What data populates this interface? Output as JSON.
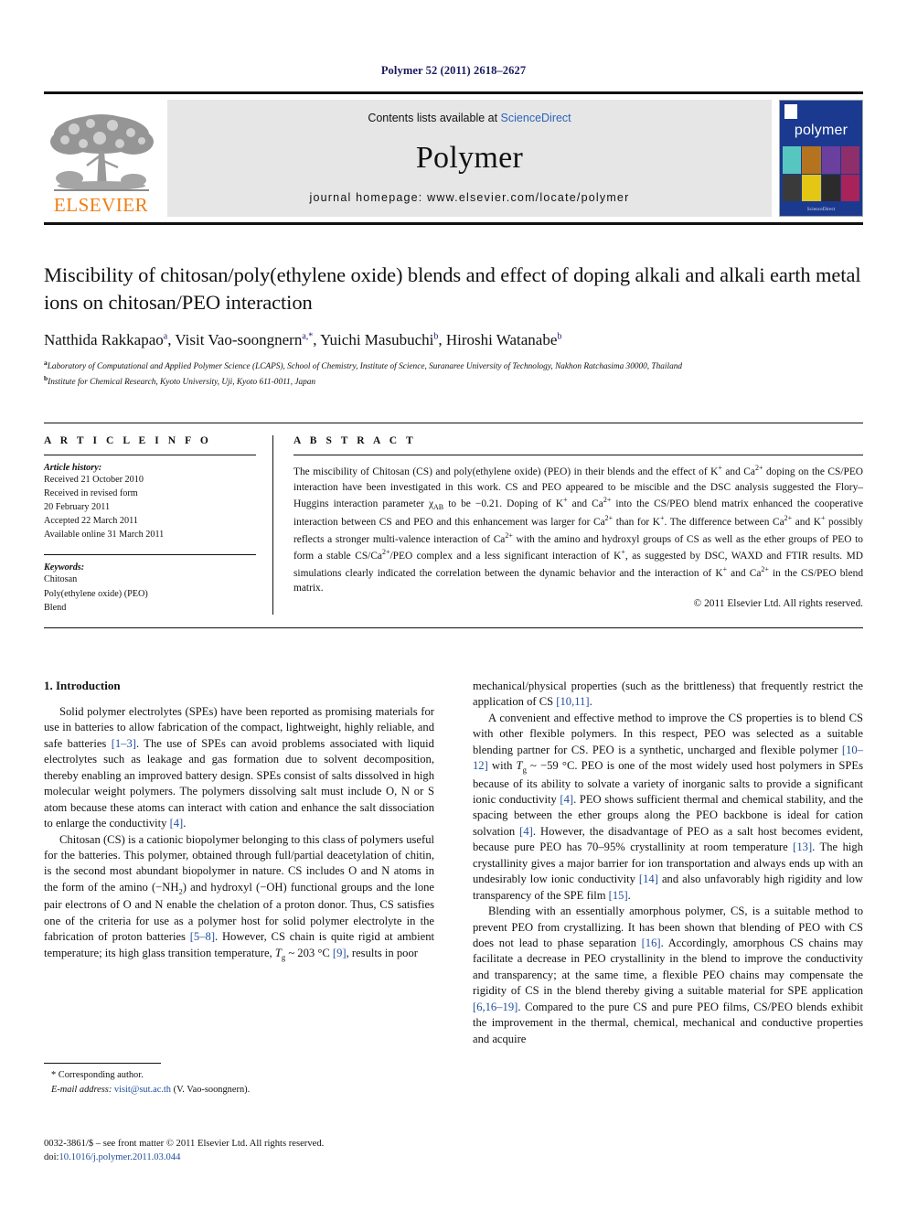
{
  "running_head": "Polymer 52 (2011) 2618–2627",
  "masthead": {
    "publisher_name": "ELSEVIER",
    "contents_prefix": "Contents lists available at ",
    "contents_link": "ScienceDirect",
    "journal_name": "Polymer",
    "homepage": "journal homepage: www.elsevier.com/locate/polymer",
    "cover_title": "polymer",
    "cover_footer": "ScienceDirect",
    "link_color": "#2b64b8",
    "elsevier_orange": "#F07E13",
    "cover_blue": "#1b3a8f"
  },
  "article": {
    "title": "Miscibility of chitosan/poly(ethylene oxide) blends and effect of doping alkali and alkali earth metal ions on chitosan/PEO interaction",
    "authors": [
      {
        "name": "Natthida Rakkapao",
        "marks": "a"
      },
      {
        "name": "Visit Vao-soongnern",
        "marks": "a,*"
      },
      {
        "name": "Yuichi Masubuchi",
        "marks": "b"
      },
      {
        "name": "Hiroshi Watanabe",
        "marks": "b"
      }
    ],
    "affiliations": [
      {
        "mark": "a",
        "text": "Laboratory of Computational and Applied Polymer Science (LCAPS), School of Chemistry, Institute of Science, Suranaree University of Technology, Nakhon Ratchasima 30000, Thailand"
      },
      {
        "mark": "b",
        "text": "Institute for Chemical Research, Kyoto University, Uji, Kyoto 611-0011, Japan"
      }
    ]
  },
  "article_info": {
    "heading": "A R T I C L E  I N F O",
    "history_label": "Article history:",
    "history_lines": [
      "Received 21 October 2010",
      "Received in revised form",
      "20 February 2011",
      "Accepted 22 March 2011",
      "Available online 31 March 2011"
    ],
    "keywords_label": "Keywords:",
    "keywords": [
      "Chitosan",
      "Poly(ethylene oxide) (PEO)",
      "Blend"
    ]
  },
  "abstract": {
    "heading": "A B S T R A C T",
    "text_parts": [
      "The miscibility of Chitosan (CS) and poly(ethylene oxide) (PEO) in their blends and the effect of K",
      "+",
      " and Ca",
      "2+",
      " doping on the CS/PEO interaction have been investigated in this work. CS and PEO appeared to be miscible and the DSC analysis suggested the Flory–Huggins interaction parameter χ",
      "AB",
      " to be −0.21. Doping of K",
      "+",
      " and Ca",
      "2+",
      " into the CS/PEO blend matrix enhanced the cooperative interaction between CS and PEO and this enhancement was larger for Ca",
      "2+",
      " than for K",
      "+",
      ". The difference between Ca",
      "2+",
      " and K",
      "+",
      " possibly reflects a stronger multi-valence interaction of Ca",
      "2+",
      " with the amino and hydroxyl groups of CS as well as the ether groups of PEO to form a stable CS/Ca",
      "2+",
      "/PEO complex and a less significant interaction of K",
      "+",
      ", as suggested by DSC, WAXD and FTIR results. MD simulations clearly indicated the correlation between the dynamic behavior and the interaction of K",
      "+",
      " and Ca",
      "2+",
      " in the CS/PEO blend matrix."
    ],
    "copyright": "© 2011 Elsevier Ltd. All rights reserved."
  },
  "body": {
    "section_heading": "1. Introduction",
    "left_paragraphs": [
      "Solid polymer electrolytes (SPEs) have been reported as promising materials for use in batteries to allow fabrication of the compact, lightweight, highly reliable, and safe batteries [1–3]. The use of SPEs can avoid problems associated with liquid electrolytes such as leakage and gas formation due to solvent decomposition, thereby enabling an improved battery design. SPEs consist of salts dissolved in high molecular weight polymers. The polymers dissolving salt must include O, N or S atom because these atoms can interact with cation and enhance the salt dissociation to enlarge the conductivity [4].",
      "Chitosan (CS) is a cationic biopolymer belonging to this class of polymers useful for the batteries. This polymer, obtained through full/partial deacetylation of chitin, is the second most abundant biopolymer in nature. CS includes O and N atoms in the form of the amino (−NH2) and hydroxyl (−OH) functional groups and the lone pair electrons of O and N enable the chelation of a proton donor. Thus, CS satisfies one of the criteria for use as a polymer host for solid polymer electrolyte in the fabrication of proton batteries [5–8]. However, CS chain is quite rigid at ambient temperature; its high glass transition temperature, Tg ~ 203 °C [9], results in poor"
    ],
    "right_paragraphs": [
      "mechanical/physical properties (such as the brittleness) that frequently restrict the application of CS [10,11].",
      "A convenient and effective method to improve the CS properties is to blend CS with other flexible polymers. In this respect, PEO was selected as a suitable blending partner for CS. PEO is a synthetic, uncharged and flexible polymer [10–12] with Tg ~ −59 °C. PEO is one of the most widely used host polymers in SPEs because of its ability to solvate a variety of inorganic salts to provide a significant ionic conductivity [4]. PEO shows sufficient thermal and chemical stability, and the spacing between the ether groups along the PEO backbone is ideal for cation solvation [4]. However, the disadvantage of PEO as a salt host becomes evident, because pure PEO has 70–95% crystallinity at room temperature [13]. The high crystallinity gives a major barrier for ion transportation and always ends up with an undesirably low ionic conductivity [14] and also unfavorably high rigidity and low transparency of the SPE film [15].",
      "Blending with an essentially amorphous polymer, CS, is a suitable method to prevent PEO from crystallizing. It has been shown that blending of PEO with CS does not lead to phase separation [16]. Accordingly, amorphous CS chains may facilitate a decrease in PEO crystallinity in the blend to improve the conductivity and transparency; at the same time, a flexible PEO chains may compensate the rigidity of CS in the blend thereby giving a suitable material for SPE application [6,16–19]. Compared to the pure CS and pure PEO films, CS/PEO blends exhibit the improvement in the thermal, chemical, mechanical and conductive properties and acquire"
    ]
  },
  "footnote": {
    "corresponding": "* Corresponding author.",
    "email_label": "E-mail address:",
    "email": "visit@sut.ac.th",
    "email_owner": "(V. Vao-soongnern)."
  },
  "footer": {
    "issn_line": "0032-3861/$ – see front matter © 2011 Elsevier Ltd. All rights reserved.",
    "doi_prefix": "doi:",
    "doi": "10.1016/j.polymer.2011.03.044"
  }
}
